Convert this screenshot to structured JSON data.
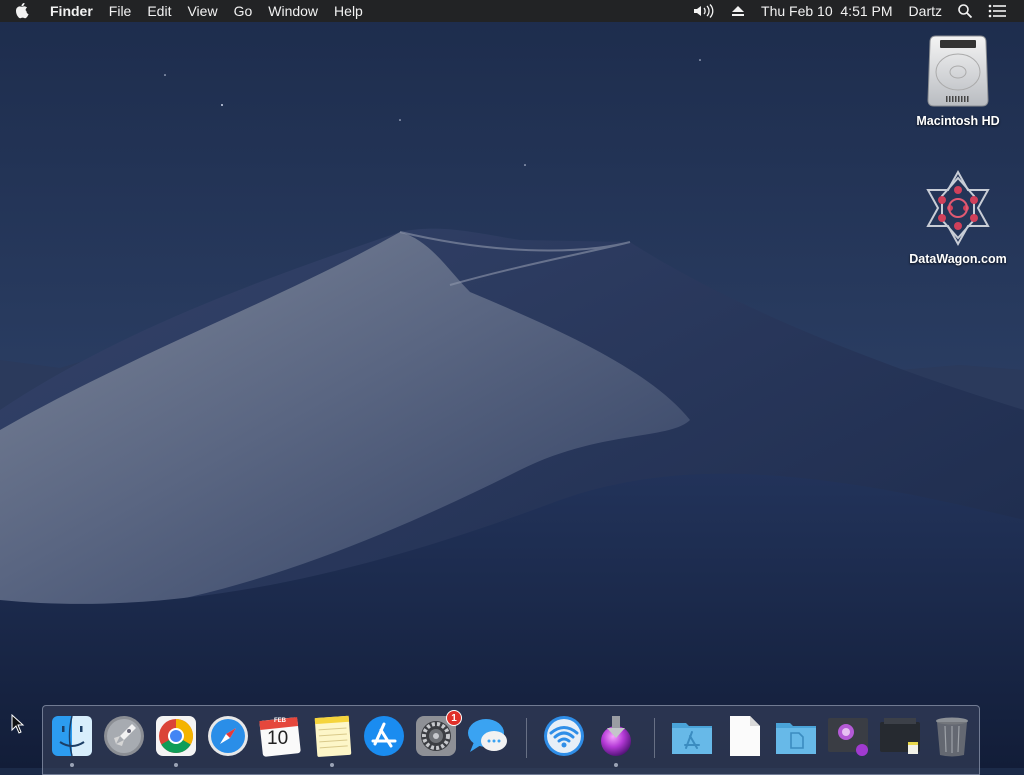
{
  "menubar": {
    "app_name": "Finder",
    "menus": [
      "File",
      "Edit",
      "View",
      "Go",
      "Window",
      "Help"
    ],
    "datetime": "Thu Feb 10  4:51 PM",
    "user": "Dartz",
    "icons": [
      "apple-icon",
      "volume-icon",
      "eject-icon",
      "spotlight-search-icon",
      "notification-center-icon"
    ]
  },
  "desktop": {
    "icons": [
      {
        "label": "Macintosh HD",
        "icon": "hard-drive-icon"
      },
      {
        "label": "DataWagon.com",
        "icon": "network-volume-icon"
      }
    ]
  },
  "dock": {
    "apps": [
      {
        "name": "Finder",
        "icon": "finder-icon",
        "running": true
      },
      {
        "name": "Launchpad",
        "icon": "launchpad-icon",
        "running": false
      },
      {
        "name": "Google Chrome",
        "icon": "chrome-icon",
        "running": true
      },
      {
        "name": "Safari",
        "icon": "safari-icon",
        "running": false
      },
      {
        "name": "Calendar",
        "icon": "calendar-icon",
        "running": false,
        "month": "FEB",
        "day": "10"
      },
      {
        "name": "Notes",
        "icon": "notes-icon",
        "running": true
      },
      {
        "name": "App Store",
        "icon": "app-store-icon",
        "running": false
      },
      {
        "name": "System Preferences",
        "icon": "system-preferences-icon",
        "running": false,
        "badge": "1"
      },
      {
        "name": "Messages",
        "icon": "messages-icon",
        "running": false
      },
      {
        "name": "Wireless Diagnostics",
        "icon": "wifi-icon",
        "running": false
      },
      {
        "name": "Installer",
        "icon": "installer-icon",
        "running": true
      }
    ],
    "others": [
      {
        "name": "Applications",
        "icon": "applications-folder-icon"
      },
      {
        "name": "Document",
        "icon": "document-icon"
      },
      {
        "name": "Documents",
        "icon": "documents-folder-icon"
      },
      {
        "name": "Downloads stack",
        "icon": "downloads-stack-icon"
      },
      {
        "name": "Stack",
        "icon": "stack-icon"
      },
      {
        "name": "Trash",
        "icon": "trash-icon"
      }
    ]
  },
  "colors": {
    "menubar": "#222325",
    "badge": "#e0302a",
    "folder": "#5fb3e8"
  }
}
